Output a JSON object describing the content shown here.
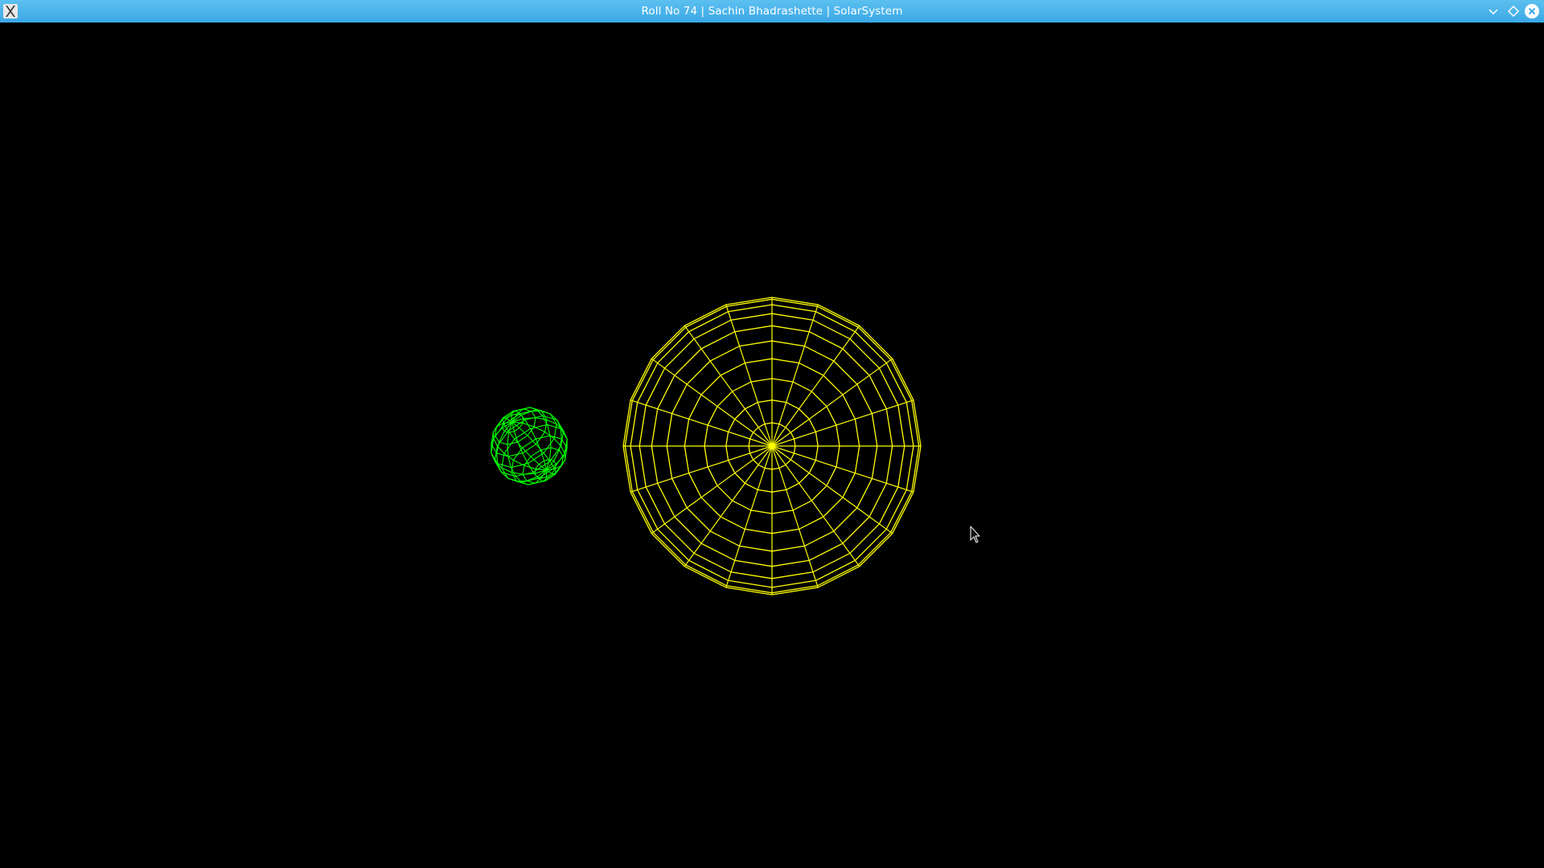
{
  "window": {
    "title": "Roll No 74 | Sachin Bhadrashette | SolarSystem",
    "app_icon": "x11-icon",
    "controls": [
      "minimize-icon",
      "maximize-icon",
      "close-icon"
    ]
  },
  "scene": {
    "background": "#000000",
    "sun": {
      "color": "#ffff00",
      "style": "wireframe-sphere"
    },
    "planet": {
      "color": "#00ff00",
      "style": "wireframe-sphere"
    }
  },
  "colors": {
    "titlebar": "#4db6ec",
    "title_text": "#ffffff"
  }
}
